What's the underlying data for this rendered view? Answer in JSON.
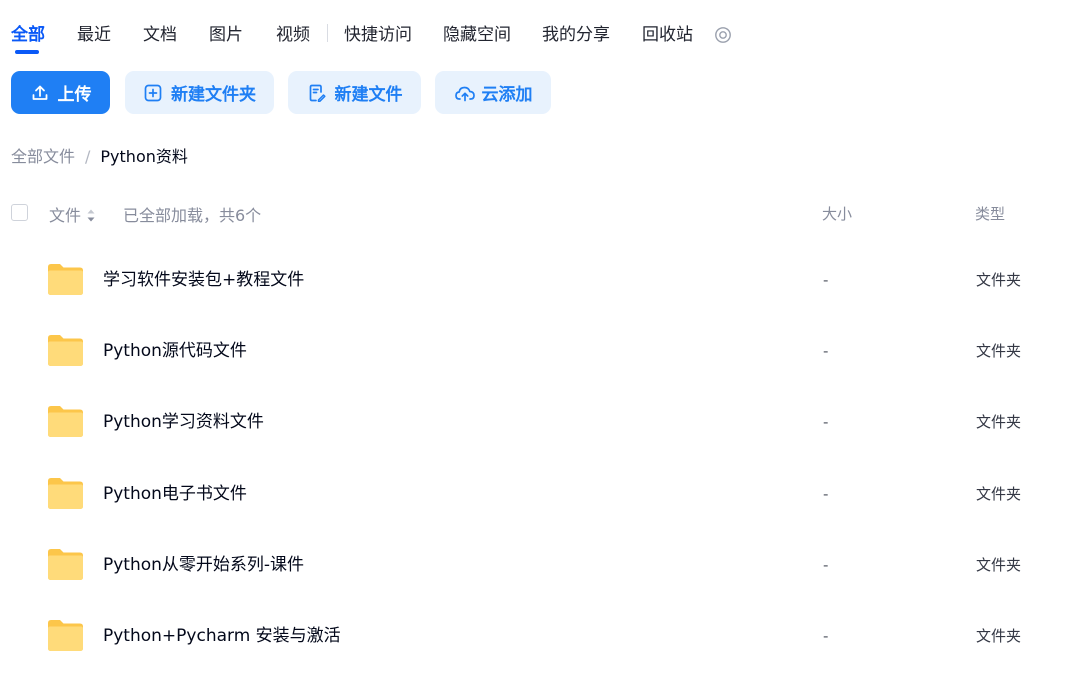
{
  "tabs": [
    {
      "label": "全部",
      "active": true
    },
    {
      "label": "最近",
      "active": false
    },
    {
      "label": "文档",
      "active": false
    },
    {
      "label": "图片",
      "active": false
    },
    {
      "label": "视频",
      "active": false
    },
    {
      "label": "快捷访问",
      "active": false
    },
    {
      "label": "隐藏空间",
      "active": false
    },
    {
      "label": "我的分享",
      "active": false
    },
    {
      "label": "回收站",
      "active": false
    }
  ],
  "toolbar": {
    "upload_label": "上传",
    "new_folder_label": "新建文件夹",
    "new_file_label": "新建文件",
    "cloud_add_label": "云添加",
    "icons": {
      "upload": "upload-icon",
      "new_folder": "folder-plus-icon",
      "new_file": "file-edit-icon",
      "cloud_add": "cloud-upload-icon"
    }
  },
  "breadcrumb": {
    "root": "全部文件",
    "separator": "/",
    "current": "Python资料"
  },
  "list_header": {
    "name": "文件",
    "status": "已全部加载，共6个",
    "size": "大小",
    "type": "类型"
  },
  "files": [
    {
      "name": "学习软件安装包+教程文件",
      "size": "-",
      "type": "文件夹"
    },
    {
      "name": "Python源代码文件",
      "size": "-",
      "type": "文件夹"
    },
    {
      "name": "Python学习资料文件",
      "size": "-",
      "type": "文件夹"
    },
    {
      "name": "Python电子书文件",
      "size": "-",
      "type": "文件夹"
    },
    {
      "name": "Python从零开始系列-课件",
      "size": "-",
      "type": "文件夹"
    },
    {
      "name": "Python+Pycharm 安装与激活",
      "size": "-",
      "type": "文件夹"
    }
  ],
  "colors": {
    "accent": "#0a59f7",
    "primary_button": "#1f7ff4",
    "secondary_button_bg": "#e8f2fd",
    "folder_yellow": "#ffd25e",
    "muted_text": "#878c9c"
  }
}
